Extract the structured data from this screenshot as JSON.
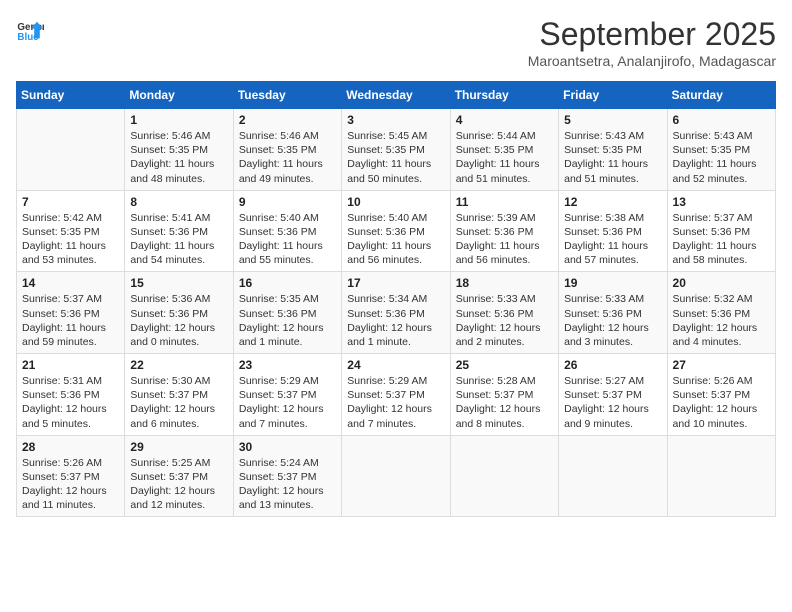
{
  "header": {
    "logo_line1": "General",
    "logo_line2": "Blue",
    "month": "September 2025",
    "location": "Maroantsetra, Analanjirofo, Madagascar"
  },
  "days_of_week": [
    "Sunday",
    "Monday",
    "Tuesday",
    "Wednesday",
    "Thursday",
    "Friday",
    "Saturday"
  ],
  "weeks": [
    [
      {
        "day": "",
        "info": ""
      },
      {
        "day": "1",
        "info": "Sunrise: 5:46 AM\nSunset: 5:35 PM\nDaylight: 11 hours\nand 48 minutes."
      },
      {
        "day": "2",
        "info": "Sunrise: 5:46 AM\nSunset: 5:35 PM\nDaylight: 11 hours\nand 49 minutes."
      },
      {
        "day": "3",
        "info": "Sunrise: 5:45 AM\nSunset: 5:35 PM\nDaylight: 11 hours\nand 50 minutes."
      },
      {
        "day": "4",
        "info": "Sunrise: 5:44 AM\nSunset: 5:35 PM\nDaylight: 11 hours\nand 51 minutes."
      },
      {
        "day": "5",
        "info": "Sunrise: 5:43 AM\nSunset: 5:35 PM\nDaylight: 11 hours\nand 51 minutes."
      },
      {
        "day": "6",
        "info": "Sunrise: 5:43 AM\nSunset: 5:35 PM\nDaylight: 11 hours\nand 52 minutes."
      }
    ],
    [
      {
        "day": "7",
        "info": "Sunrise: 5:42 AM\nSunset: 5:35 PM\nDaylight: 11 hours\nand 53 minutes."
      },
      {
        "day": "8",
        "info": "Sunrise: 5:41 AM\nSunset: 5:36 PM\nDaylight: 11 hours\nand 54 minutes."
      },
      {
        "day": "9",
        "info": "Sunrise: 5:40 AM\nSunset: 5:36 PM\nDaylight: 11 hours\nand 55 minutes."
      },
      {
        "day": "10",
        "info": "Sunrise: 5:40 AM\nSunset: 5:36 PM\nDaylight: 11 hours\nand 56 minutes."
      },
      {
        "day": "11",
        "info": "Sunrise: 5:39 AM\nSunset: 5:36 PM\nDaylight: 11 hours\nand 56 minutes."
      },
      {
        "day": "12",
        "info": "Sunrise: 5:38 AM\nSunset: 5:36 PM\nDaylight: 11 hours\nand 57 minutes."
      },
      {
        "day": "13",
        "info": "Sunrise: 5:37 AM\nSunset: 5:36 PM\nDaylight: 11 hours\nand 58 minutes."
      }
    ],
    [
      {
        "day": "14",
        "info": "Sunrise: 5:37 AM\nSunset: 5:36 PM\nDaylight: 11 hours\nand 59 minutes."
      },
      {
        "day": "15",
        "info": "Sunrise: 5:36 AM\nSunset: 5:36 PM\nDaylight: 12 hours\nand 0 minutes."
      },
      {
        "day": "16",
        "info": "Sunrise: 5:35 AM\nSunset: 5:36 PM\nDaylight: 12 hours\nand 1 minute."
      },
      {
        "day": "17",
        "info": "Sunrise: 5:34 AM\nSunset: 5:36 PM\nDaylight: 12 hours\nand 1 minute."
      },
      {
        "day": "18",
        "info": "Sunrise: 5:33 AM\nSunset: 5:36 PM\nDaylight: 12 hours\nand 2 minutes."
      },
      {
        "day": "19",
        "info": "Sunrise: 5:33 AM\nSunset: 5:36 PM\nDaylight: 12 hours\nand 3 minutes."
      },
      {
        "day": "20",
        "info": "Sunrise: 5:32 AM\nSunset: 5:36 PM\nDaylight: 12 hours\nand 4 minutes."
      }
    ],
    [
      {
        "day": "21",
        "info": "Sunrise: 5:31 AM\nSunset: 5:36 PM\nDaylight: 12 hours\nand 5 minutes."
      },
      {
        "day": "22",
        "info": "Sunrise: 5:30 AM\nSunset: 5:37 PM\nDaylight: 12 hours\nand 6 minutes."
      },
      {
        "day": "23",
        "info": "Sunrise: 5:29 AM\nSunset: 5:37 PM\nDaylight: 12 hours\nand 7 minutes."
      },
      {
        "day": "24",
        "info": "Sunrise: 5:29 AM\nSunset: 5:37 PM\nDaylight: 12 hours\nand 7 minutes."
      },
      {
        "day": "25",
        "info": "Sunrise: 5:28 AM\nSunset: 5:37 PM\nDaylight: 12 hours\nand 8 minutes."
      },
      {
        "day": "26",
        "info": "Sunrise: 5:27 AM\nSunset: 5:37 PM\nDaylight: 12 hours\nand 9 minutes."
      },
      {
        "day": "27",
        "info": "Sunrise: 5:26 AM\nSunset: 5:37 PM\nDaylight: 12 hours\nand 10 minutes."
      }
    ],
    [
      {
        "day": "28",
        "info": "Sunrise: 5:26 AM\nSunset: 5:37 PM\nDaylight: 12 hours\nand 11 minutes."
      },
      {
        "day": "29",
        "info": "Sunrise: 5:25 AM\nSunset: 5:37 PM\nDaylight: 12 hours\nand 12 minutes."
      },
      {
        "day": "30",
        "info": "Sunrise: 5:24 AM\nSunset: 5:37 PM\nDaylight: 12 hours\nand 13 minutes."
      },
      {
        "day": "",
        "info": ""
      },
      {
        "day": "",
        "info": ""
      },
      {
        "day": "",
        "info": ""
      },
      {
        "day": "",
        "info": ""
      }
    ]
  ]
}
